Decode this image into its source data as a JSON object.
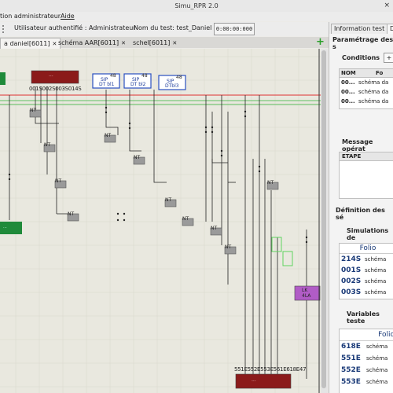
{
  "window": {
    "title": "Simu_RPR 2.0"
  },
  "menu": {
    "items": [
      "tion administrateur",
      "Aide"
    ]
  },
  "status": {
    "user_label": "Utilisateur authentifié : Administrateur",
    "test_label": "Nom du test: test_Daniel",
    "time": "0:00:00:000"
  },
  "tabs": [
    {
      "label": "a daniel[6011]",
      "active": true
    },
    {
      "label": "schéma AAR[6011]",
      "active": false
    },
    {
      "label": "schel[6011]",
      "active": false
    }
  ],
  "canvas": {
    "red_block_top": "...",
    "dt_boxes": [
      {
        "tag": "48",
        "line1": "SIP",
        "line2": "DT bl1"
      },
      {
        "tag": "48",
        "line1": "SIP",
        "line2": "DT bl2"
      },
      {
        "tag": "48",
        "line1": "SIP",
        "line2": "DTbl3"
      }
    ],
    "folio_labels_top": "001S002S003S014S",
    "green_block_label": "...",
    "nt_labels": [
      "NT",
      "NT",
      "NT",
      "NT",
      "NT",
      "NT",
      "NT",
      "NT",
      "NT",
      "NT",
      "NT"
    ],
    "purple_block": {
      "line1": "LK",
      "line2": "4LA"
    },
    "bottom_labels": "551E552E553E561E618E47",
    "bottom_red_block": "..."
  },
  "right_panel": {
    "tabs": [
      "Information test",
      "Do"
    ],
    "parametrage": "Paramétrage des s",
    "conditions_label": "Conditions",
    "add_button": "+",
    "conditions_table": {
      "headers": [
        "NOM",
        "Fo"
      ],
      "rows": [
        [
          "00...",
          "schéma da"
        ],
        [
          "00...",
          "schéma da"
        ],
        [
          "00...",
          "schéma da"
        ]
      ]
    },
    "message_label": "Message opérat",
    "message_table_header": "ETAPE",
    "definition_label": "Définition des sé",
    "simulations_label": "Simulations de",
    "simulations_table": {
      "header": "Folio",
      "rows": [
        [
          "214S",
          "schéma"
        ],
        [
          "001S",
          "schéma"
        ],
        [
          "002S",
          "schéma"
        ],
        [
          "003S",
          "schéma"
        ]
      ]
    },
    "variables_label": "Variables teste",
    "variables_table": {
      "header": "Folio",
      "rows": [
        [
          "618E",
          "schéma"
        ],
        [
          "551E",
          "schéma"
        ],
        [
          "552E",
          "schéma"
        ],
        [
          "553E",
          "schéma"
        ]
      ]
    }
  }
}
